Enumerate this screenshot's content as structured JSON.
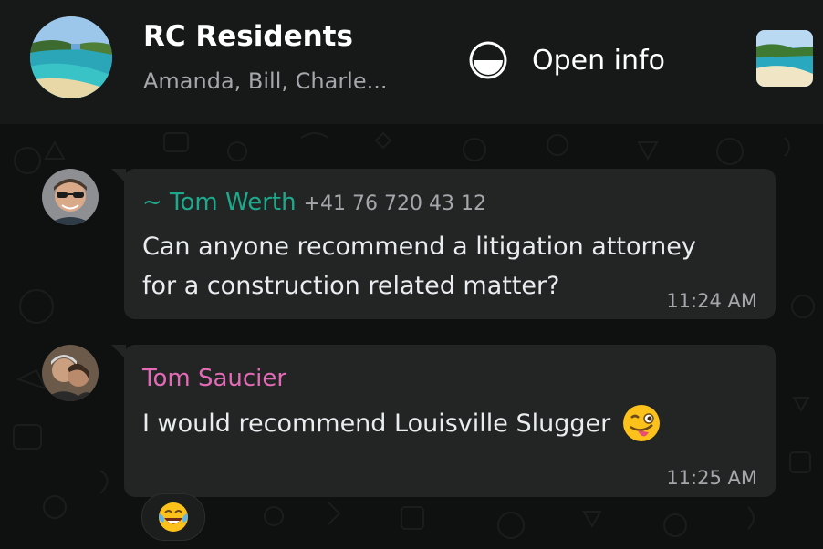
{
  "header": {
    "title": "RC Residents",
    "subtitle": "Amanda, Bill, Charle...",
    "open_info_label": "Open info",
    "group_avatar": "beach-photo",
    "media_thumbnail": "beach-photo"
  },
  "messages": [
    {
      "sender": "~ Tom Werth",
      "phone": "+41 76 720 43 12",
      "sender_color": "#1daa8c",
      "lines": [
        "Can anyone recommend a litigation attorney",
        "for a construction related matter?"
      ],
      "time": "11:24 AM",
      "avatar": "man-with-sunglasses-photo"
    },
    {
      "sender": "Tom Saucier",
      "sender_color": "#e26ab6",
      "text": "I would recommend Louisville Slugger",
      "emoji": "winking-face-with-tongue",
      "time": "11:25 AM",
      "avatar": "couple-photo",
      "reaction": "face-with-tears-of-joy"
    }
  ]
}
